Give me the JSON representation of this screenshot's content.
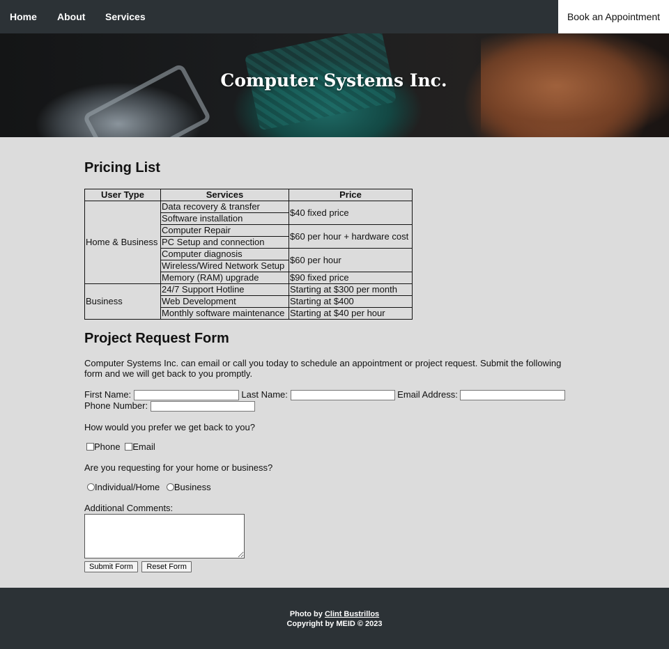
{
  "nav": {
    "items": [
      "Home",
      "About",
      "Services"
    ],
    "book_label": "Book an Appointment"
  },
  "hero": {
    "title": "Computer Systems Inc."
  },
  "pricing": {
    "heading": "Pricing List",
    "headers": [
      "User Type",
      "Services",
      "Price"
    ],
    "groups": [
      {
        "user_type": "Home & Business",
        "services": [
          "Data recovery & transfer",
          "Software installation",
          "Computer Repair",
          "PC Setup and connection",
          "Computer diagnosis",
          "Wireless/Wired Network Setup",
          "Memory (RAM) upgrade"
        ],
        "prices": [
          "$40 fixed price",
          "$60 per hour + hardware cost",
          "$60 per hour",
          "$90 fixed price"
        ]
      },
      {
        "user_type": "Business",
        "services": [
          "24/7 Support Hotline",
          "Web Development",
          "Monthly software maintenance"
        ],
        "prices": [
          "Starting at $300 per month",
          "Starting at $400",
          "Starting at $40 per hour"
        ]
      }
    ]
  },
  "form": {
    "heading": "Project Request Form",
    "intro": "Computer Systems Inc. can email or call you today to schedule an appointment or project request. Submit the following form and we will get back to you promptly.",
    "first_name_label": "First Name:",
    "last_name_label": "Last Name:",
    "email_label": "Email Address:",
    "phone_label": "Phone Number:",
    "first_name_value": "",
    "last_name_value": "",
    "email_value": "",
    "phone_value": "",
    "contact_question": "How would you prefer we get back to you?",
    "contact_options": [
      "Phone",
      "Email"
    ],
    "type_question": "Are you requesting for your home or business?",
    "type_options": [
      "Individual/Home",
      "Business"
    ],
    "comments_label": "Additional Comments:",
    "submit_label": "Submit Form",
    "reset_label": "Reset Form"
  },
  "footer": {
    "photo_prefix": "Photo by",
    "photo_credit": "Clint Bustrillos",
    "copyright": "Copyright by MEID © 2023"
  },
  "colors": {
    "nav_bg": "#2c3236",
    "page_bg": "#dcdcdc"
  }
}
